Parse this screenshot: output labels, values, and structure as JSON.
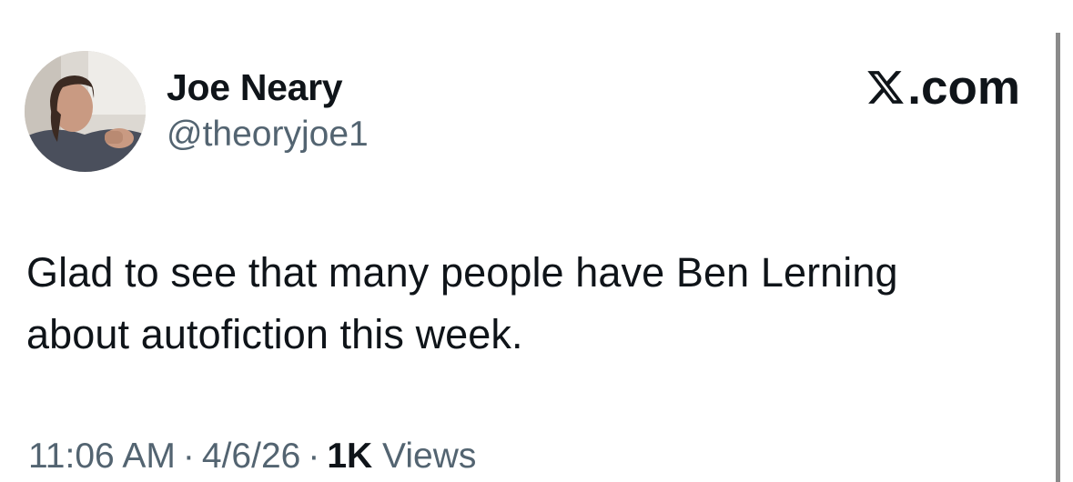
{
  "author": {
    "display_name": "Joe Neary",
    "handle": "@theoryjoe1",
    "avatar_icon": "profile-photo"
  },
  "brand": {
    "icon": "x-logo-icon",
    "text": ".com"
  },
  "tweet": {
    "line1": "Glad to see that many people have Ben Lerning",
    "line2": "about autofiction this week."
  },
  "meta": {
    "time": "11:06 AM",
    "separator": "·",
    "date": "4/6/26",
    "views_count": "1K",
    "views_label": "Views"
  },
  "colors": {
    "text_primary": "#0f1419",
    "text_secondary": "#536471",
    "background": "#ffffff",
    "scrollbar": "#8a8a8a"
  }
}
